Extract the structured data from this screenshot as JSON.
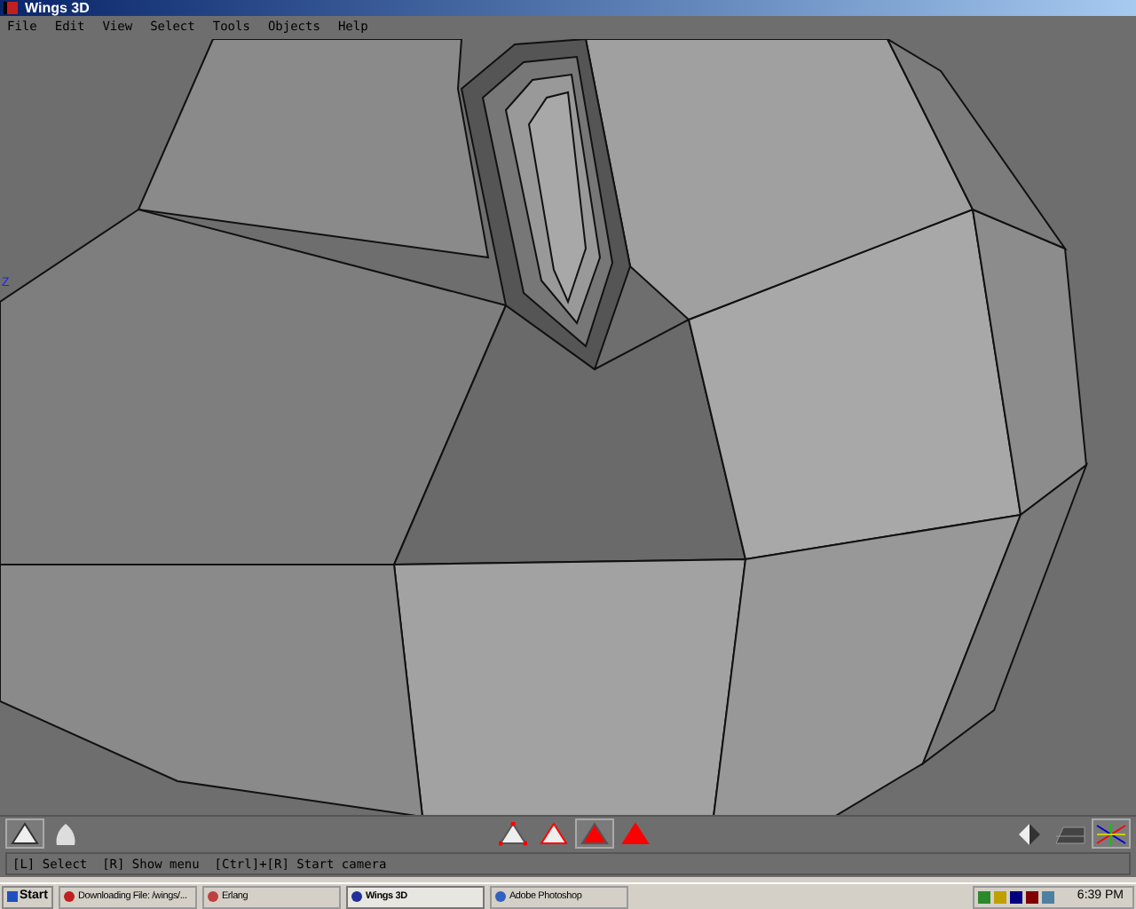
{
  "window": {
    "title": "Wings 3D"
  },
  "menu": [
    "File",
    "Edit",
    "View",
    "Select",
    "Tools",
    "Objects",
    "Help"
  ],
  "viewport": {
    "axis_label": "Z"
  },
  "view_buttons": [
    {
      "kind": "smooth-off",
      "selected": true
    },
    {
      "kind": "smooth-on",
      "selected": false
    }
  ],
  "selection_modes": [
    {
      "kind": "vertex",
      "selected": false
    },
    {
      "kind": "edge",
      "selected": false
    },
    {
      "kind": "face",
      "selected": true
    },
    {
      "kind": "body",
      "selected": false
    }
  ],
  "display_buttons": [
    {
      "kind": "shading",
      "selected": false
    },
    {
      "kind": "groundplane",
      "selected": false
    },
    {
      "kind": "axes",
      "selected": true
    }
  ],
  "status_bar": "[L] Select  [R] Show menu  [Ctrl]+[R] Start camera",
  "taskbar": {
    "start": "Start",
    "tasks": [
      {
        "label": "Downloading File: /wings/...",
        "selected": false
      },
      {
        "label": "Erlang",
        "selected": false
      },
      {
        "label": "Wings 3D",
        "selected": true
      },
      {
        "label": "Adobe Photoshop",
        "selected": false
      }
    ],
    "clock": "6:39 PM"
  }
}
